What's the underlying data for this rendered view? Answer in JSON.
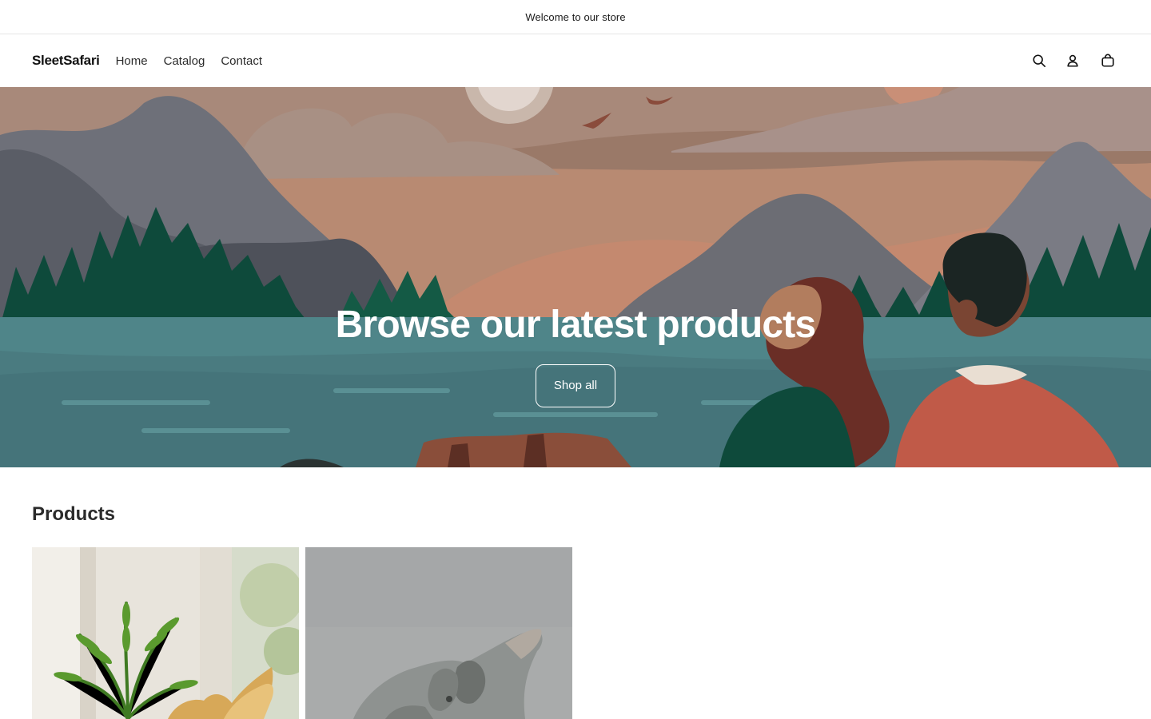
{
  "announcement": {
    "text": "Welcome to our store"
  },
  "header": {
    "logo": "SleetSafari",
    "nav": [
      {
        "label": "Home"
      },
      {
        "label": "Catalog"
      },
      {
        "label": "Contact"
      }
    ],
    "icons": [
      "search-icon",
      "account-icon",
      "cart-icon"
    ]
  },
  "hero": {
    "title": "Browse our latest products",
    "button_label": "Shop all"
  },
  "products": {
    "heading": "Products",
    "items": [
      {
        "image": "product-image-1"
      },
      {
        "image": "product-image-2"
      }
    ]
  }
}
